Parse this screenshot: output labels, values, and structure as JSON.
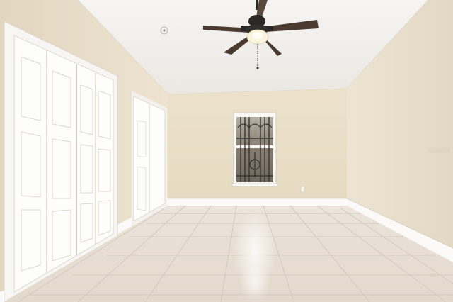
{
  "scene": {
    "subject": "empty-bedroom-interior",
    "features": [
      "vaulted-ceiling",
      "ceiling-fan",
      "bifold-closet-doors",
      "single-window-with-security-bars",
      "white-baseboards",
      "light-tile-floor"
    ],
    "colors": {
      "ceiling": "#f1efec",
      "wall_back": "#eadfc8",
      "wall_left": "#e8dcc7",
      "wall_right": "#e9dfcb",
      "floor": "#e7ddd2",
      "tile_grout": "#d4c8bb",
      "trim": "#fbfaf8",
      "closet_door": "#fdfdfc",
      "fan_blade": "#4a3a30",
      "fan_metal": "#2b2826",
      "window_view": "#8d8478"
    }
  }
}
